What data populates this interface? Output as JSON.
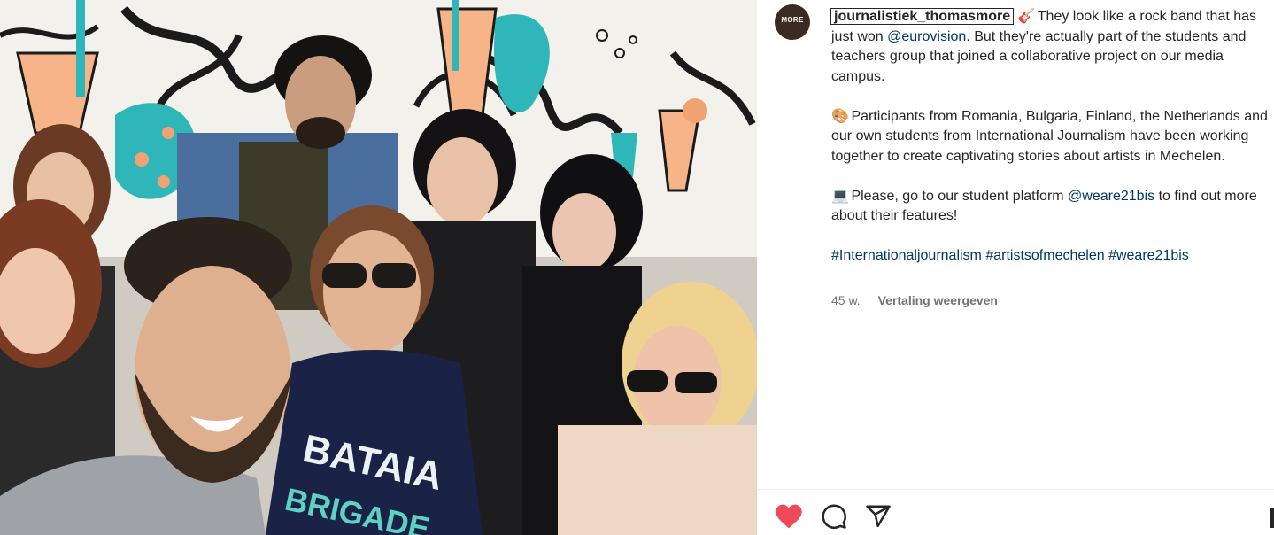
{
  "post": {
    "username": "journalistiek_thomasmore",
    "avatar_text": "MORE",
    "caption": {
      "p1_emoji": "🎸",
      "p1_a": "They look like a rock band that has just won ",
      "p1_mention": "@eurovision",
      "p1_b": ". But they're actually part of the students and teachers group that joined a collaborative project on our media campus.",
      "p2_emoji": "🎨",
      "p2": "Participants from Romania, Bulgaria, Finland, the Netherlands and our own students from International Journalism have been working together to create captivating stories about artists in Mechelen.",
      "p3_emoji": "💻",
      "p3_a": "Please, go to our student platform ",
      "p3_mention": "@weare21bis",
      "p3_b": " to find out more about their features!",
      "hashtags": [
        "#Internationaljournalism",
        "#artistsofmechelen",
        "#weare21bis"
      ]
    },
    "time_ago": "45 w.",
    "translate_label": "Vertaling weergeven",
    "shirt_text_1": "BATAIA",
    "shirt_text_2": "BRIGADE"
  },
  "actions": {
    "like_icon": "heart-filled-icon",
    "comment_icon": "comment-icon",
    "share_icon": "paper-plane-icon",
    "save_icon": "bookmark-icon"
  },
  "colors": {
    "like_red": "#ed4956",
    "link_blue": "#00376b",
    "text": "#262626",
    "muted": "#737373",
    "mural_teal": "#2fb6b8",
    "mural_orange": "#f0a372"
  }
}
